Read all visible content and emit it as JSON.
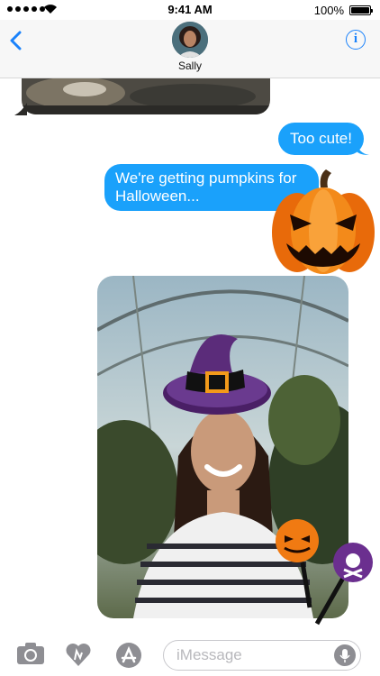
{
  "status_bar": {
    "time": "9:41 AM",
    "battery": "100%"
  },
  "header": {
    "contact_name": "Sally"
  },
  "messages": [
    {
      "text": "Too cute!"
    },
    {
      "text": "We're getting pumpkins for Halloween..."
    }
  ],
  "input": {
    "placeholder": "iMessage"
  },
  "colors": {
    "bubble": "#1aa1fb",
    "accent": "#1a82fb"
  }
}
